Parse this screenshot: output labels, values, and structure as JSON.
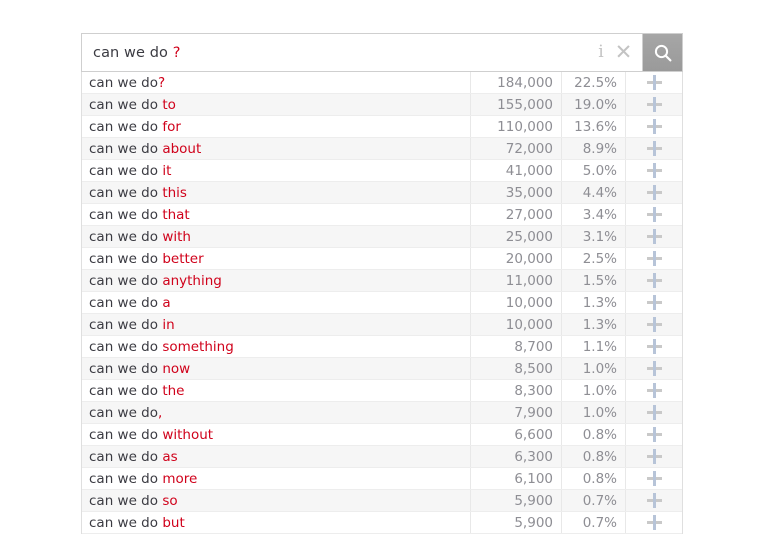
{
  "search": {
    "query_prefix": "can we do ",
    "query_token": "?",
    "info_icon": "info-icon",
    "clear_icon": "close-icon",
    "search_icon": "search-icon"
  },
  "results": {
    "prefix": "can we do",
    "rows": [
      {
        "prefix": "can we do",
        "suffix": "?",
        "separator": "",
        "volume": "184,000",
        "percent": "22.5%",
        "add": "+"
      },
      {
        "prefix": "can we do",
        "suffix": "to",
        "separator": " ",
        "volume": "155,000",
        "percent": "19.0%",
        "add": "+"
      },
      {
        "prefix": "can we do",
        "suffix": "for",
        "separator": " ",
        "volume": "110,000",
        "percent": "13.6%",
        "add": "+"
      },
      {
        "prefix": "can we do",
        "suffix": "about",
        "separator": " ",
        "volume": "72,000",
        "percent": "8.9%",
        "add": "+"
      },
      {
        "prefix": "can we do",
        "suffix": "it",
        "separator": " ",
        "volume": "41,000",
        "percent": "5.0%",
        "add": "+"
      },
      {
        "prefix": "can we do",
        "suffix": "this",
        "separator": " ",
        "volume": "35,000",
        "percent": "4.4%",
        "add": "+"
      },
      {
        "prefix": "can we do",
        "suffix": "that",
        "separator": " ",
        "volume": "27,000",
        "percent": "3.4%",
        "add": "+"
      },
      {
        "prefix": "can we do",
        "suffix": "with",
        "separator": " ",
        "volume": "25,000",
        "percent": "3.1%",
        "add": "+"
      },
      {
        "prefix": "can we do",
        "suffix": "better",
        "separator": " ",
        "volume": "20,000",
        "percent": "2.5%",
        "add": "+"
      },
      {
        "prefix": "can we do",
        "suffix": "anything",
        "separator": " ",
        "volume": "11,000",
        "percent": "1.5%",
        "add": "+"
      },
      {
        "prefix": "can we do",
        "suffix": "a",
        "separator": " ",
        "volume": "10,000",
        "percent": "1.3%",
        "add": "+"
      },
      {
        "prefix": "can we do",
        "suffix": "in",
        "separator": " ",
        "volume": "10,000",
        "percent": "1.3%",
        "add": "+"
      },
      {
        "prefix": "can we do",
        "suffix": "something",
        "separator": " ",
        "volume": "8,700",
        "percent": "1.1%",
        "add": "+"
      },
      {
        "prefix": "can we do",
        "suffix": "now",
        "separator": " ",
        "volume": "8,500",
        "percent": "1.0%",
        "add": "+"
      },
      {
        "prefix": "can we do",
        "suffix": "the",
        "separator": " ",
        "volume": "8,300",
        "percent": "1.0%",
        "add": "+"
      },
      {
        "prefix": "can we do",
        "suffix": ",",
        "separator": "",
        "volume": "7,900",
        "percent": "1.0%",
        "add": "+"
      },
      {
        "prefix": "can we do",
        "suffix": "without",
        "separator": " ",
        "volume": "6,600",
        "percent": "0.8%",
        "add": "+"
      },
      {
        "prefix": "can we do",
        "suffix": "as",
        "separator": " ",
        "volume": "6,300",
        "percent": "0.8%",
        "add": "+"
      },
      {
        "prefix": "can we do",
        "suffix": "more",
        "separator": " ",
        "volume": "6,100",
        "percent": "0.8%",
        "add": "+"
      },
      {
        "prefix": "can we do",
        "suffix": "so",
        "separator": " ",
        "volume": "5,900",
        "percent": "0.7%",
        "add": "+"
      },
      {
        "prefix": "can we do",
        "suffix": "but",
        "separator": " ",
        "volume": "5,900",
        "percent": "0.7%",
        "add": "+"
      }
    ]
  },
  "colors": {
    "suffix_red": "#d0021b",
    "text_dark": "#3b3b42",
    "value_gray": "#8e8e94",
    "row_alt": "#f6f6f6",
    "search_button": "#9a9a9a"
  }
}
